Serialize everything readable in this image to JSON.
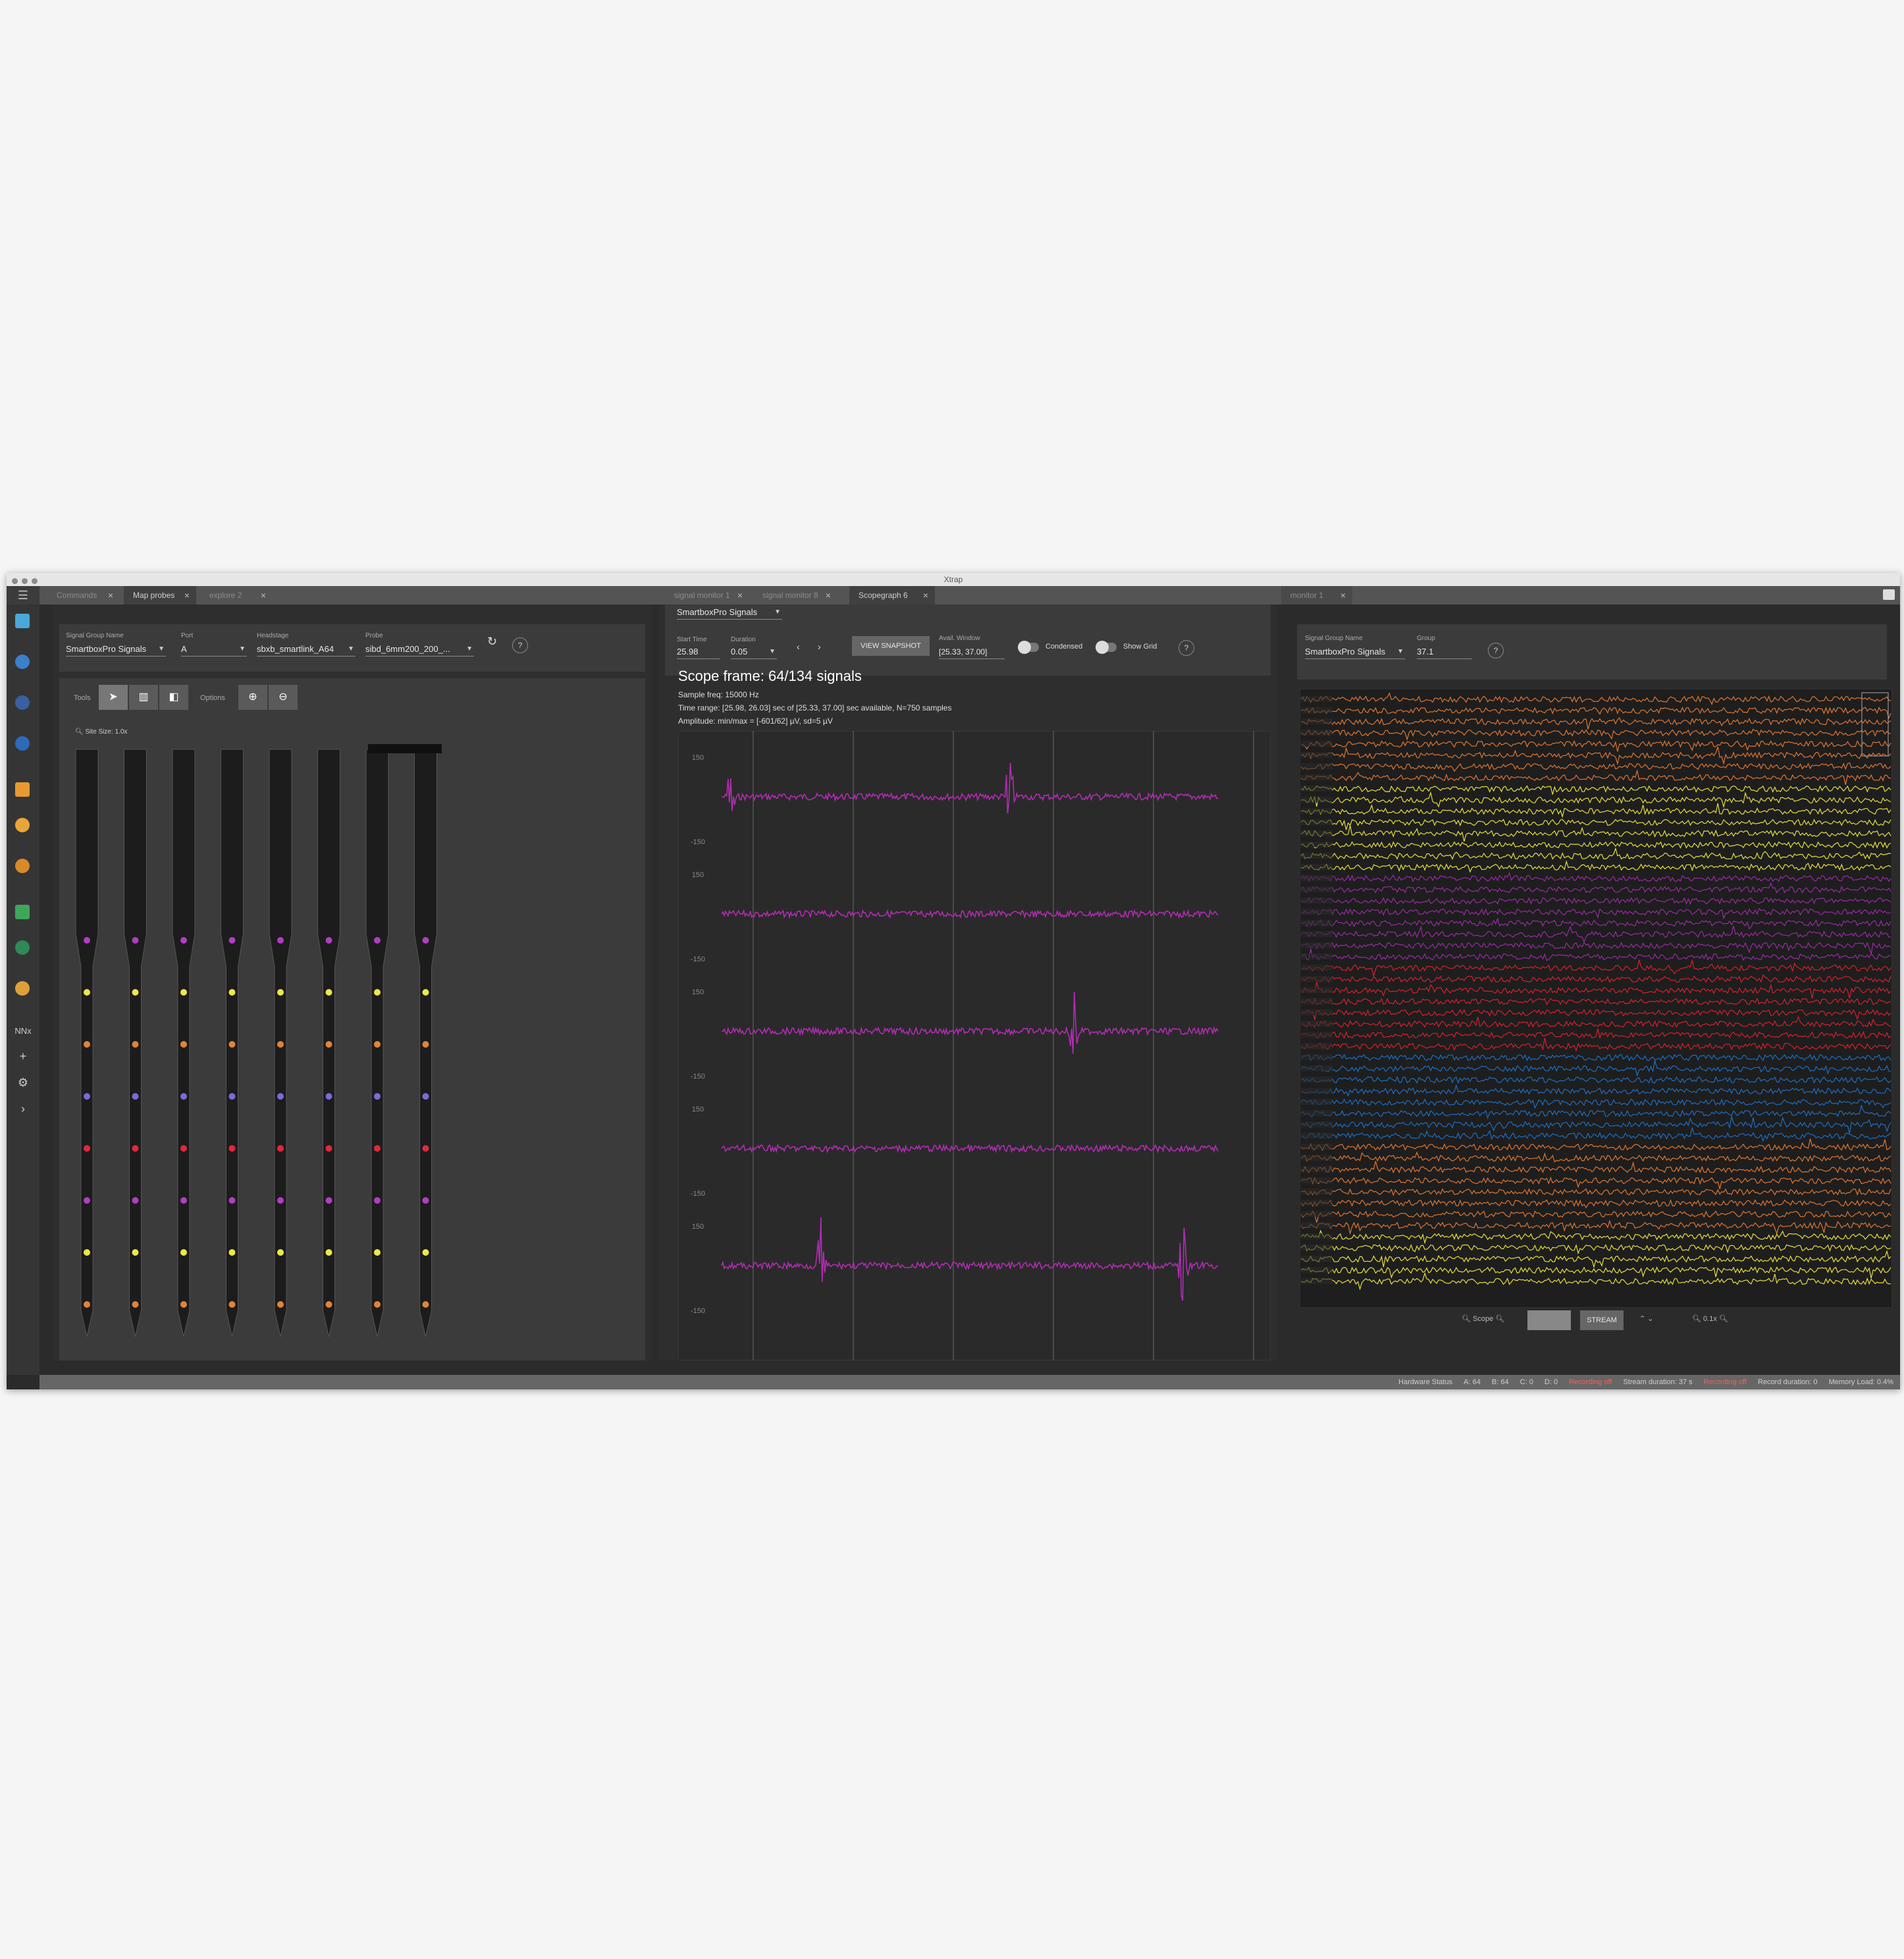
{
  "window": {
    "title": "Xtrap"
  },
  "tabs_left": [
    {
      "label": "Commands",
      "active": false
    },
    {
      "label": "Map probes",
      "active": true
    },
    {
      "label": "explore 2",
      "active": false
    }
  ],
  "tabs_mid": [
    {
      "label": "signal monitor 1",
      "active": false
    },
    {
      "label": "signal monitor 8",
      "active": false
    },
    {
      "label": "Scopegraph 6",
      "active": true
    }
  ],
  "tabs_right": [
    {
      "label": "monitor 1",
      "active": true
    }
  ],
  "sidebar": {
    "icons": [
      "display-icon",
      "globe-icon",
      "probe-icon",
      "filter-icon",
      "chart-icon",
      "database-icon",
      "compass-icon",
      "grid-icon",
      "network-icon",
      "layers-icon"
    ],
    "nn_label": "NNx",
    "icons_bottom": [
      "plus-icon",
      "gear-icon",
      "chevron-right-icon"
    ]
  },
  "probe_map": {
    "signal_group": {
      "label": "Signal Group Name",
      "value": "SmartboxPro Signals"
    },
    "port": {
      "label": "Port",
      "value": "A"
    },
    "headstage": {
      "label": "Headstage",
      "value": "sbxb_smartlink_A64"
    },
    "probe": {
      "label": "Probe",
      "value": "sibd_6mm200_200_..."
    },
    "tools_label": "Tools",
    "options_label": "Options",
    "zoom_label": "Site Size: 1.0x",
    "shanks": 8,
    "site_colors": [
      "#b23cc4",
      "#ece84a",
      "#e0843a",
      "#7b6bd8",
      "#e0283c",
      "#b23cc4",
      "#ece84a",
      "#e0843a"
    ]
  },
  "scope": {
    "signal_group": "SmartboxPro Signals",
    "start_time_label": "Start Time",
    "start_time": "25.98",
    "duration_label": "Duration",
    "duration": "0.05",
    "snapshot_button": "VIEW SNAPSHOT",
    "avail_window_label": "Avail. Window",
    "avail_window": "[25.33, 37.00]",
    "condensed_label": "Condensed",
    "show_grid_label": "Show Grid",
    "title": "Scope frame: 64/134 signals",
    "sample_freq": "Sample freq: 15000 Hz",
    "time_range": "Time range: [25.98, 26.03] sec of [25.33, 37.00] sec available, N=750 samples",
    "amplitude": "Amplitude: min/max = [-601/62] µV, sd=5 µV",
    "trace_color": "#b12cb2",
    "traces": [
      {
        "top": "150",
        "bottom": "-150",
        "spikes": [
          0.02,
          0.58
        ]
      },
      {
        "top": "150",
        "bottom": "-150",
        "spikes": []
      },
      {
        "top": "150",
        "bottom": "-150",
        "spikes": [
          0.71
        ]
      },
      {
        "top": "150",
        "bottom": "-150",
        "spikes": []
      },
      {
        "top": "150",
        "bottom": "-150",
        "spikes": [
          0.2,
          0.93
        ]
      }
    ]
  },
  "monitor": {
    "signal_group": {
      "label": "Signal Group Name",
      "value": "SmartboxPro Signals"
    },
    "group": {
      "label": "Group",
      "value": "37.1"
    },
    "color_bands": [
      "#e0762f",
      "#e6df3a",
      "#9b2aa6",
      "#d8202c",
      "#1c6fc4",
      "#e0762f",
      "#e6df3a"
    ],
    "rows_per_band": 8,
    "rows_in_last_band": 5,
    "zoom_label": "Scope",
    "stream_button": "STREAM",
    "zoom2_label": "0.1x"
  },
  "status_bar": {
    "hardware": "Hardware Status",
    "a": "A: 64",
    "b": "B: 64",
    "c": "C: 0",
    "d": "D: 0",
    "rec1": "Recording off",
    "stream_dur": "Stream duration: 37 s",
    "rec2": "Recording off",
    "rec_dur": "Record duration: 0",
    "memory": "Memory Load: 0.4%"
  }
}
